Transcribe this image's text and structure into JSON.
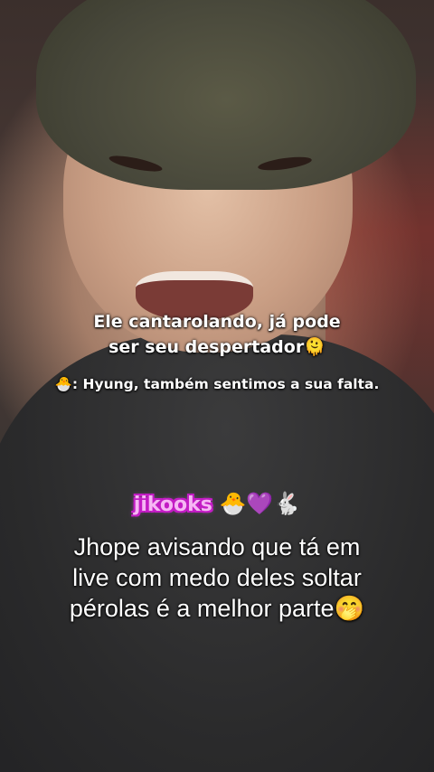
{
  "overlay": {
    "top_caption_line1": "Ele cantarolando, já pode",
    "top_caption_line2": "ser seu despertador",
    "top_caption_emoji": "🫠",
    "sub_caption_emoji": "🐣",
    "sub_caption": ": Hyung, também sentimos a sua falta.",
    "handle": "jikooks",
    "handle_emojis": "🐣💜🐇",
    "main_caption_line1": "Jhope avisando que tá em",
    "main_caption_line2": "live com medo deles soltar",
    "main_caption_line3": "pérolas é a melhor parte",
    "main_caption_emoji": "🤭"
  }
}
